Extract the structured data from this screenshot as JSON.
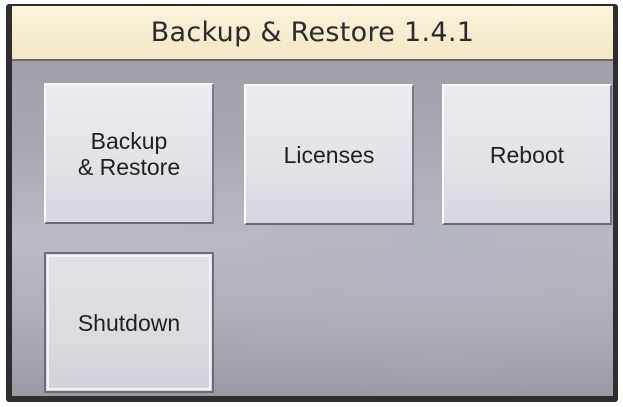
{
  "window": {
    "title": "Backup & Restore 1.4.1"
  },
  "menu": {
    "items": [
      {
        "id": "backup-restore",
        "label": "Backup\n& Restore"
      },
      {
        "id": "licenses",
        "label": "Licenses"
      },
      {
        "id": "reboot",
        "label": "Reboot"
      },
      {
        "id": "shutdown",
        "label": "Shutdown"
      }
    ]
  },
  "colors": {
    "title_bar": "#f3e8c4",
    "background": "#aeadb8",
    "tile_face": "#e3e2e9",
    "text": "#1f1f22"
  }
}
